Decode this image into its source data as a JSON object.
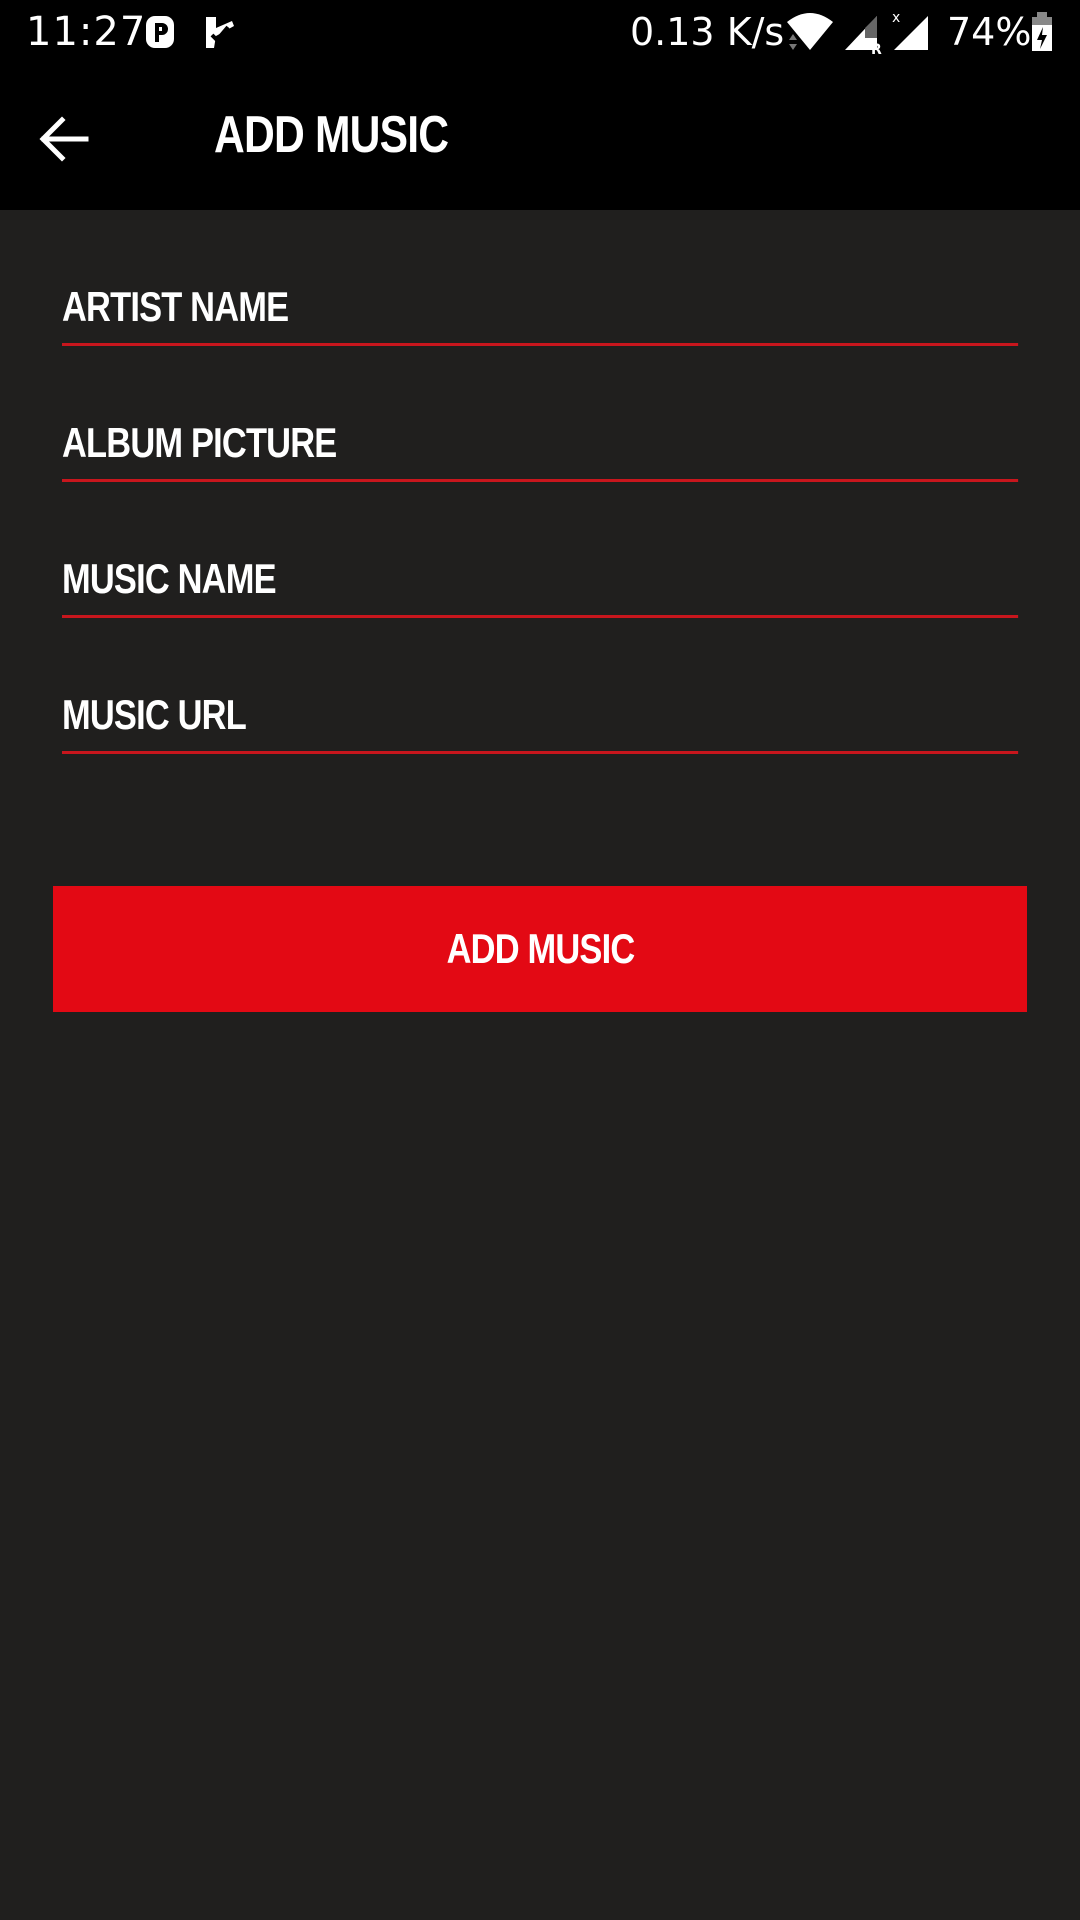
{
  "status_bar": {
    "time": "11:27",
    "network_speed": "0.13 K/s",
    "battery_percent": "74%",
    "icons": [
      "parking-app-icon",
      "checkmark-app-icon",
      "wifi-icon",
      "signal-roaming-icon",
      "signal-no-data-icon",
      "battery-charging-icon"
    ]
  },
  "app_bar": {
    "title": "ADD MUSIC",
    "back_icon": "arrow-left-icon"
  },
  "form": {
    "artist_name": {
      "placeholder": "ARTIST NAME",
      "value": ""
    },
    "album_picture": {
      "placeholder": "ALBUM PICTURE",
      "value": ""
    },
    "music_name": {
      "placeholder": "MUSIC NAME",
      "value": ""
    },
    "music_url": {
      "placeholder": "MUSIC URL",
      "value": ""
    }
  },
  "submit_button": {
    "label": "ADD MUSIC"
  },
  "colors": {
    "background": "#201f1e",
    "bar": "#000000",
    "accent": "#e30914",
    "underline": "#c8161d",
    "text": "#ffffff"
  }
}
